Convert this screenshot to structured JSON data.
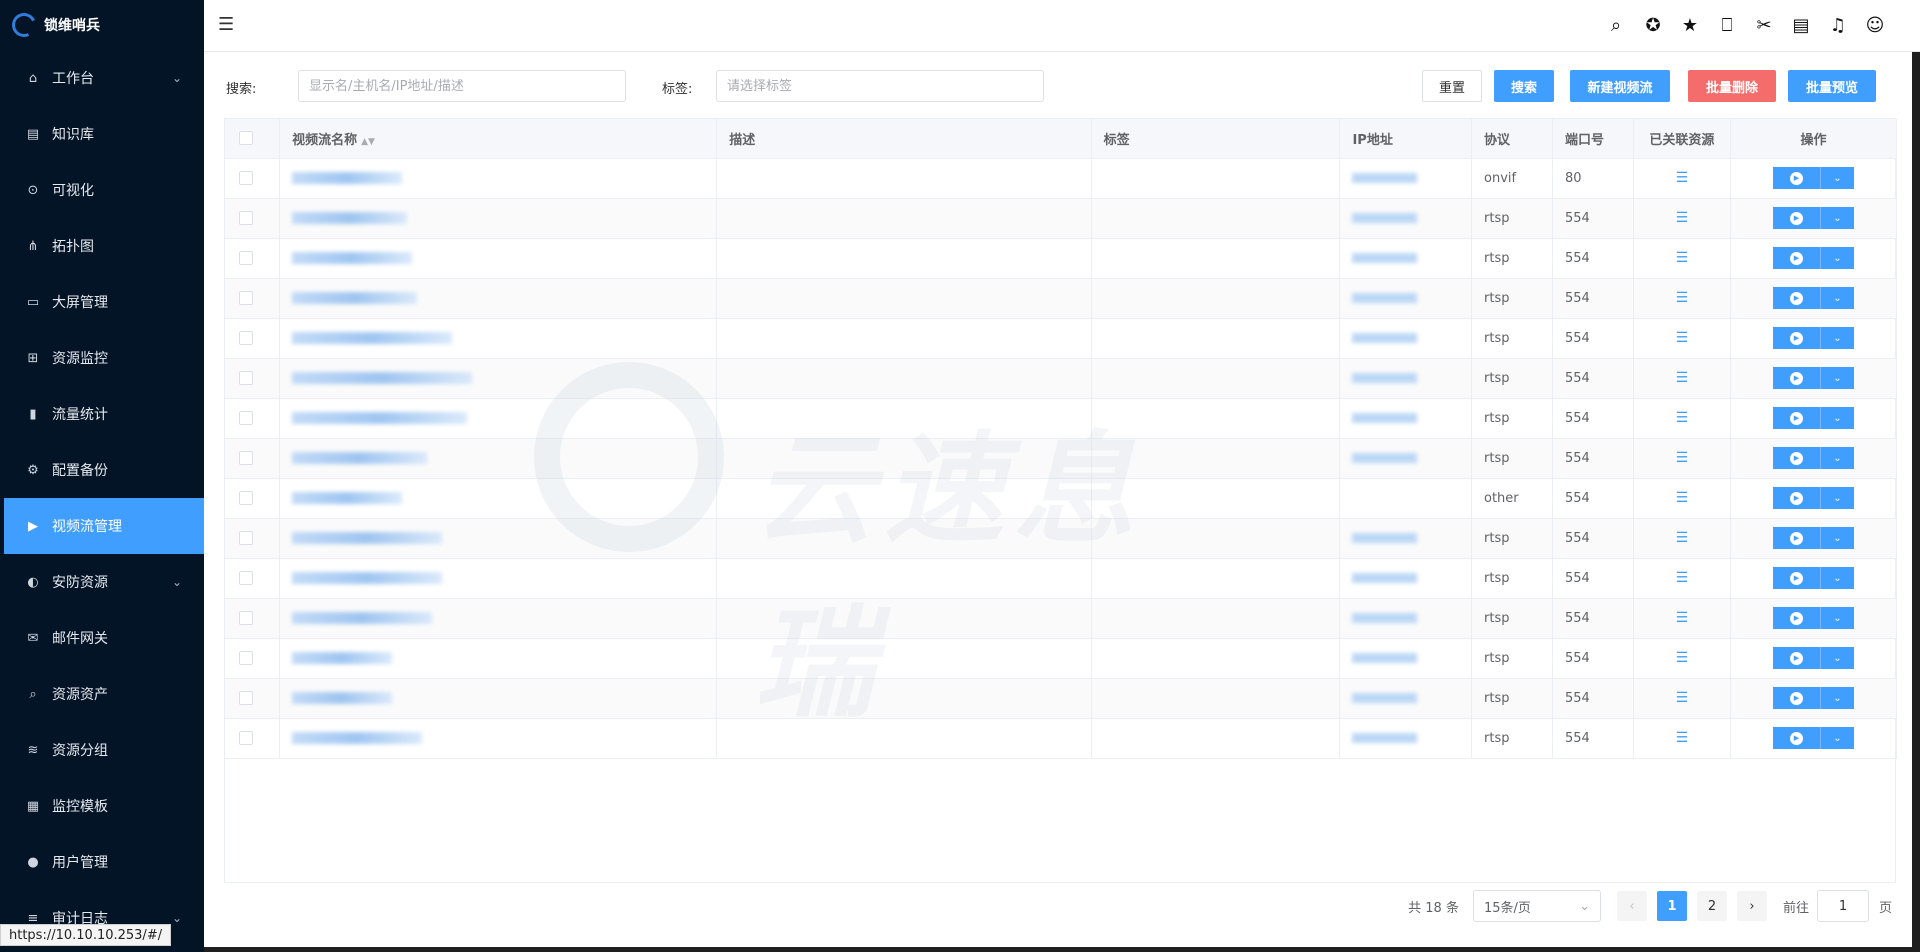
{
  "brand": {
    "name": "锁维哨兵"
  },
  "sidebar": {
    "items": [
      {
        "label": "工作台",
        "icon": "home-icon",
        "glyph": "⌂",
        "has_children": true
      },
      {
        "label": "知识库",
        "icon": "book-icon",
        "glyph": "▤",
        "has_children": false
      },
      {
        "label": "可视化",
        "icon": "zoom-icon",
        "glyph": "⊙",
        "has_children": false
      },
      {
        "label": "拓扑图",
        "icon": "topology-icon",
        "glyph": "⋔",
        "has_children": false
      },
      {
        "label": "大屏管理",
        "icon": "monitor-icon",
        "glyph": "▭",
        "has_children": false
      },
      {
        "label": "资源监控",
        "icon": "grid-icon",
        "glyph": "⊞",
        "has_children": false
      },
      {
        "label": "流量统计",
        "icon": "bar-chart-icon",
        "glyph": "▮",
        "has_children": false
      },
      {
        "label": "配置备份",
        "icon": "cogs-icon",
        "glyph": "⚙",
        "has_children": false
      },
      {
        "label": "视频流管理",
        "icon": "video-camera-icon",
        "glyph": "▶",
        "has_children": false,
        "active": true
      },
      {
        "label": "安防资源",
        "icon": "shield-icon",
        "glyph": "◐",
        "has_children": true
      },
      {
        "label": "邮件网关",
        "icon": "mail-icon",
        "glyph": "✉",
        "has_children": false
      },
      {
        "label": "资源资产",
        "icon": "search-icon",
        "glyph": "⌕",
        "has_children": false
      },
      {
        "label": "资源分组",
        "icon": "layers-icon",
        "glyph": "≋",
        "has_children": false
      },
      {
        "label": "监控模板",
        "icon": "template-icon",
        "glyph": "▦",
        "has_children": false
      },
      {
        "label": "用户管理",
        "icon": "user-icon",
        "glyph": "●",
        "has_children": false
      },
      {
        "label": "审计日志",
        "icon": "log-icon",
        "glyph": "≡",
        "has_children": true
      }
    ]
  },
  "header": {
    "icons": [
      {
        "name": "search-icon",
        "glyph": "⌕"
      },
      {
        "name": "ai-chat-icon",
        "glyph": "✪"
      },
      {
        "name": "star-icon",
        "glyph": "★"
      },
      {
        "name": "bookmark-icon",
        "glyph": "⎕"
      },
      {
        "name": "tools-icon",
        "glyph": "✂"
      },
      {
        "name": "storage-icon",
        "glyph": "▤"
      },
      {
        "name": "bell-icon",
        "glyph": "♫"
      },
      {
        "name": "user-icon",
        "glyph": "☺"
      }
    ]
  },
  "search": {
    "search_label": "搜索:",
    "search_placeholder": "显示名/主机名/IP地址/描述",
    "tag_label": "标签:",
    "tag_placeholder": "请选择标签",
    "reset": "重置",
    "search_btn": "搜索",
    "new_stream": "新建视频流",
    "batch_delete": "批量删除",
    "batch_preview": "批量预览"
  },
  "table": {
    "columns": [
      "视频流名称",
      "描述",
      "标签",
      "IP地址",
      "协议",
      "端口号",
      "已关联资源",
      "操作"
    ],
    "rows": [
      {
        "protocol": "onvif",
        "port": "80"
      },
      {
        "protocol": "rtsp",
        "port": "554"
      },
      {
        "protocol": "rtsp",
        "port": "554"
      },
      {
        "protocol": "rtsp",
        "port": "554"
      },
      {
        "protocol": "rtsp",
        "port": "554"
      },
      {
        "protocol": "rtsp",
        "port": "554"
      },
      {
        "protocol": "rtsp",
        "port": "554"
      },
      {
        "protocol": "rtsp",
        "port": "554"
      },
      {
        "protocol": "other",
        "port": "554"
      },
      {
        "protocol": "rtsp",
        "port": "554"
      },
      {
        "protocol": "rtsp",
        "port": "554"
      },
      {
        "protocol": "rtsp",
        "port": "554"
      },
      {
        "protocol": "rtsp",
        "port": "554"
      },
      {
        "protocol": "rtsp",
        "port": "554"
      },
      {
        "protocol": "rtsp",
        "port": "554"
      }
    ]
  },
  "watermark": {
    "text": "云速息瑞"
  },
  "pagination": {
    "total": "共 18 条",
    "page_size": "15条/页",
    "pages": [
      "1",
      "2"
    ],
    "current": "1",
    "goto_label": "前往",
    "goto_value": "1",
    "page_suffix": "页"
  },
  "statusbar": {
    "url": "https://10.10.10.253/#/"
  }
}
